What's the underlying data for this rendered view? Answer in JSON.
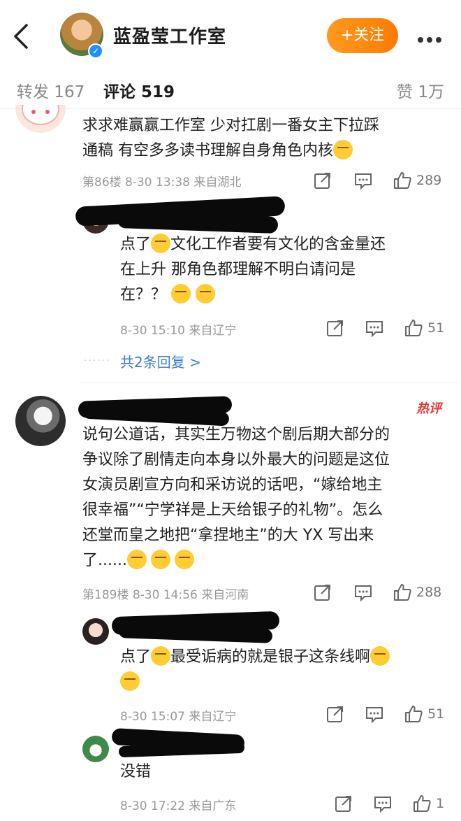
{
  "header": {
    "title": "蓝盈莹工作室",
    "follow_label": "+关注"
  },
  "tabs": {
    "repost": "转发 167",
    "comment": "评论 519",
    "like": "赞 1万"
  },
  "comments": [
    {
      "text_line1": "求求难赢赢工作室 少对扛剧一番女主下拉踩",
      "text_line2": "通稿 有空多多读书理解自身角色内核",
      "meta": "第86楼 8-30 13:38 来自湖北",
      "likes": "289",
      "reply": {
        "line1": "点了",
        "line1b": "文化工作者要有文化的含金量还",
        "line2": "在上升 那角色都理解不明白请问是",
        "line3": "在？？",
        "meta": "8-30 15:10 来自辽宁",
        "likes": "51"
      },
      "more_replies": "共2条回复 >"
    },
    {
      "hot_tag": "热评",
      "lines": [
        "说句公道话，其实生万物这个剧后期大部分的",
        "争议除了剧情走向本身以外最大的问题是这位",
        "女演员剧宣方向和采访说的话吧，“嫁给地主",
        "很幸福”“宁学祥是上天给银子的礼物”。怎么",
        "还堂而皇之地把“拿捏地主”的大 YX 写出来",
        "了......"
      ],
      "meta": "第189楼 8-30 14:56 来自河南",
      "likes": "288",
      "replies": [
        {
          "line1a": "点了",
          "line1b": "最受诟病的就是银子这条线啊",
          "meta": "8-30 15:07 来自辽宁",
          "likes": "51"
        },
        {
          "text": "没错",
          "meta": "8-30 17:22 来自广东",
          "likes": "1"
        }
      ]
    }
  ]
}
